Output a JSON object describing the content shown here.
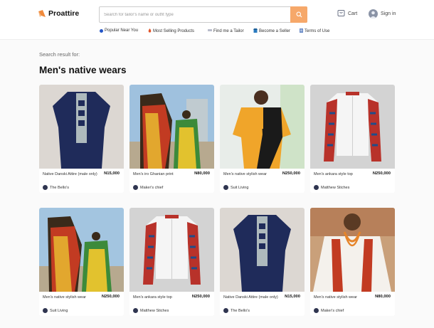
{
  "app": {
    "logo_text": "Proattire"
  },
  "search": {
    "placeholder": "Search for tailor's name or outfit type"
  },
  "header_actions": {
    "cart_label": "Cart",
    "signin_label": "Sign in"
  },
  "nav": [
    {
      "label": "Popular Near You",
      "icon": "location-dot-icon",
      "color": "#2456c7"
    },
    {
      "label": "Most Selling Products",
      "icon": "fire-icon",
      "color": "#e2552a"
    },
    {
      "label": "Find me a Tailor",
      "icon": "tailor-icon",
      "color": "#9aa0b3"
    },
    {
      "label": "Become a Seller",
      "icon": "shop-icon",
      "color": "#2b7bbf"
    },
    {
      "label": "Terms of Use",
      "icon": "document-icon",
      "color": "#6b8cc7"
    }
  ],
  "results": {
    "label": "Search result for:",
    "query": "Men's native wears"
  },
  "products": [
    {
      "name": "Native Danski Attire (male only)",
      "price": "N15,000",
      "seller": "The Bello's"
    },
    {
      "name": "Men's iro Ghanian print",
      "price": "N80,000",
      "seller": "Maker's chief"
    },
    {
      "name": "Men's native stylish wear",
      "price": "N250,000",
      "seller": "Suit Living"
    },
    {
      "name": "Men's ankara style top",
      "price": "N250,000",
      "seller": "Matthew Stiches"
    },
    {
      "name": "Men's native stylish wear",
      "price": "N250,000",
      "seller": "Suit Living"
    },
    {
      "name": "Men's ankara style top",
      "price": "N250,000",
      "seller": "Matthew Stiches"
    },
    {
      "name": "Native Danski Attire (male only)",
      "price": "N15,000",
      "seller": "The Bello's"
    },
    {
      "name": "Men's native stylish wear",
      "price": "N80,000",
      "seller": "Maker's chief"
    }
  ],
  "colors": {
    "accent": "#f6a86a",
    "brand": "#f08a3c"
  }
}
